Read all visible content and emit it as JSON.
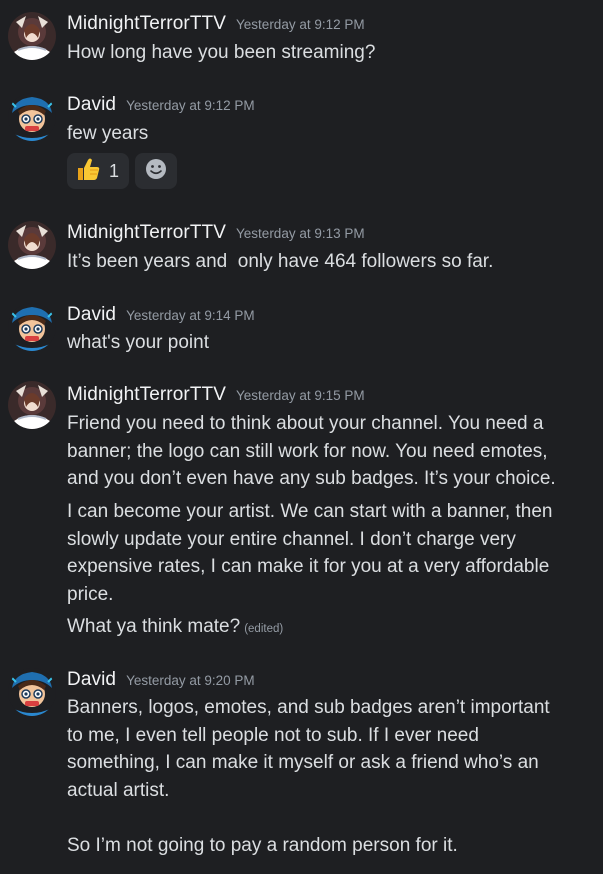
{
  "messages": [
    {
      "author": "MidnightTerrorTTV",
      "timestamp": "Yesterday at 9:12 PM",
      "lines": [
        "How long have you been streaming?"
      ]
    },
    {
      "author": "David",
      "timestamp": "Yesterday at 9:12 PM",
      "lines": [
        "few years"
      ],
      "reactions": [
        {
          "icon": "thumbs-up-icon",
          "count": "1"
        }
      ],
      "add_reaction_icon": "smiley-icon"
    },
    {
      "author": "MidnightTerrorTTV",
      "timestamp": "Yesterday at 9:13 PM",
      "lines": [
        "It’s been years and  only have 464 followers so far."
      ]
    },
    {
      "author": "David",
      "timestamp": "Yesterday at 9:14 PM",
      "lines": [
        "what's your point"
      ]
    },
    {
      "author": "MidnightTerrorTTV",
      "timestamp": "Yesterday at 9:15 PM",
      "lines": [
        "Friend you need to think about your channel. You need a banner; the logo can still work for now. You need emotes, and you don’t even have any sub badges. It’s your choice.",
        "I can become your artist. We can start with a banner, then slowly update your entire channel. I don’t charge very expensive rates, I can make it for you at a very affordable price.",
        "What ya think mate?"
      ],
      "edited_label": "(edited)"
    },
    {
      "author": "David",
      "timestamp": "Yesterday at 9:20 PM",
      "lines": [
        "Banners, logos, emotes, and sub badges aren’t important to me, I even tell people not to sub. If I ever need something, I can make it myself or ask a friend who’s an actual artist.\n\nSo I’m not going to pay a random person for it."
      ]
    }
  ],
  "colors": {
    "background": "#1e1f22",
    "username": "#f2f3f5",
    "text": "#dbdee1",
    "timestamp": "#949ba4",
    "reaction_bg": "#2b2d31"
  }
}
